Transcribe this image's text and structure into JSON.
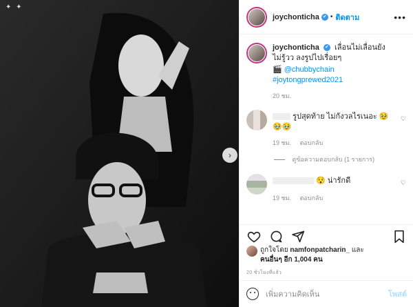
{
  "header": {
    "username": "joychonticha",
    "verified_mark": "✔",
    "separator": "•",
    "follow_label": "ติดตาม",
    "more_icon": "more-icon"
  },
  "caption": {
    "username": "joychonticha",
    "text": "เลื่อนไม่เลื่อนยังไม่รู้วว ลงรูปไปเรื่อยๆ",
    "camera_mention": "@chubbychain",
    "hashtag": "#joytongprewed2021",
    "time": "20 ชม."
  },
  "comments": [
    {
      "text": "รูปสุดท้าย ไม่กังวลไรเนอะ",
      "emoji": "🥹",
      "emoji_line": "🥹🥹",
      "time": "19 ชม.",
      "reply_label": "ตอบกลับ"
    },
    {
      "text": "น่ารักดี",
      "emoji": "😯",
      "time": "19 ชม.",
      "reply_label": "ตอบกลับ"
    }
  ],
  "view_replies": "ดูข้อความตอบกลับ (1 รายการ)",
  "likes": {
    "prefix": "ถูกใจโดย",
    "liker": "namfonpatcharin_",
    "and": "และ",
    "others": "คนอื่นๆ อีก 1,004 คน"
  },
  "posted_ago": "20 ชั่วโมงที่แล้ว",
  "comment_box": {
    "placeholder": "เพิ่มความคิดเห็น",
    "post_label": "โพสต์"
  },
  "colors": {
    "accent": "#0095f6",
    "ring": "#c13584",
    "muted": "#8e8e8e"
  }
}
